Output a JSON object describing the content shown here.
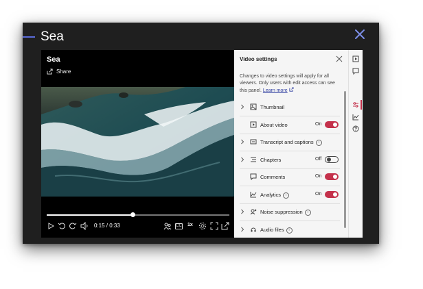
{
  "page": {
    "title": "Sea"
  },
  "player": {
    "video_title": "Sea",
    "share_label": "Share",
    "time": "0:15 / 0:33",
    "progress": 0.47,
    "speed_label": "1x",
    "cc_label": "CC"
  },
  "panel": {
    "title": "Video settings",
    "desc": "Changes to video settings will apply for all viewers. Only users with edit access can see this panel.",
    "learn_more": "Learn more",
    "rows": [
      {
        "label": "Thumbnail",
        "expandable": true,
        "icon": "image-icon"
      },
      {
        "label": "About video",
        "expandable": false,
        "icon": "play-box-icon",
        "state": "On",
        "toggle": true
      },
      {
        "label": "Transcript and captions",
        "expandable": true,
        "icon": "captions-icon",
        "info": true
      },
      {
        "label": "Chapters",
        "expandable": true,
        "icon": "list-icon",
        "state": "Off",
        "toggle": false
      },
      {
        "label": "Comments",
        "expandable": false,
        "icon": "comment-icon",
        "state": "On",
        "toggle": true
      },
      {
        "label": "Analytics",
        "expandable": false,
        "icon": "chart-icon",
        "state": "On",
        "toggle": true,
        "info": true
      },
      {
        "label": "Noise suppression",
        "expandable": true,
        "icon": "noise-icon",
        "info": true
      },
      {
        "label": "Audio files",
        "expandable": true,
        "icon": "audio-icon",
        "info": true
      }
    ]
  },
  "colors": {
    "accent": "#c4314b",
    "link": "#2f3ea0",
    "title_accent": "#5b6cdb"
  }
}
